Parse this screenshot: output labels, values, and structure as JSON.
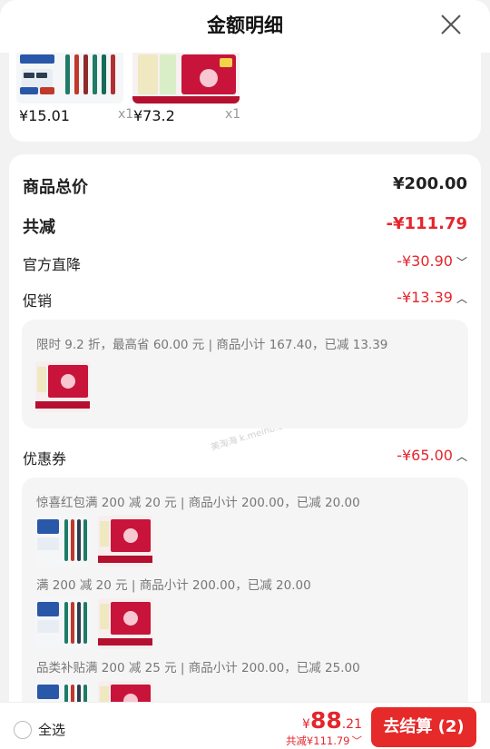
{
  "header": {
    "title": "金额明细"
  },
  "products": [
    {
      "price": "¥15.01",
      "qty": "x1",
      "image": "toothbrush-set-image"
    },
    {
      "price": "¥73.2",
      "qty": "x1",
      "image": "perfume-gift-box-image"
    }
  ],
  "summary": {
    "total_label": "商品总价",
    "total_value": "¥200.00",
    "reduce_label": "共减",
    "reduce_value": "-¥111.79",
    "official_label": "官方直降",
    "official_value": "-¥30.90",
    "promo_label": "促销",
    "promo_value": "-¥13.39",
    "coupon_label": "优惠券",
    "coupon_value": "-¥65.00"
  },
  "promo_detail": {
    "line": "限时 9.2 折，最高省 60.00 元 | 商品小计 167.40，已减 13.39"
  },
  "coupon_details": [
    {
      "line": "惊喜红包满 200 减 20 元 | 商品小计 200.00，已减 20.00"
    },
    {
      "line": "满 200 减 20 元 | 商品小计 200.00，已减 20.00"
    },
    {
      "line": "品类补贴满 200 减 25 元 | 商品小计 200.00，已减 25.00"
    }
  ],
  "watermark": "美淘海 k.meinb.com",
  "bottom": {
    "select_all": "全选",
    "currency": "¥",
    "price_int": "88",
    "price_dec": ".21",
    "discount_summary": "共减¥111.79",
    "checkout": "去结算 (2)"
  },
  "colors": {
    "accent_red": "#e4262c",
    "button_red": "#e62a2a"
  }
}
